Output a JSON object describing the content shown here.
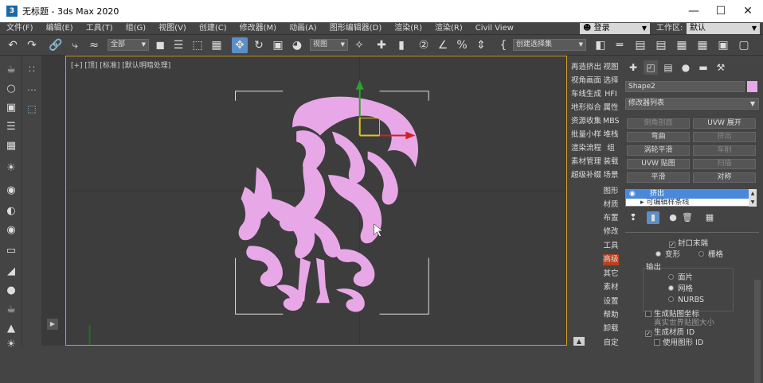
{
  "window": {
    "title": "无标题 - 3ds Max 2020",
    "app_icon": "3ds"
  },
  "menu": [
    "文件(F)",
    "编辑(E)",
    "工具(T)",
    "组(G)",
    "视图(V)",
    "创建(C)",
    "修改器(M)",
    "动画(A)",
    "图形编辑器(D)",
    "渲染(R)",
    "渲染(R)",
    "Civil View"
  ],
  "signin": {
    "label": "登录"
  },
  "workspace": {
    "label": "工作区:",
    "value": "默认"
  },
  "toolbar": {
    "selection_filter": "全部",
    "ref_coord": "视图",
    "named_selection": "创建选择集"
  },
  "viewport": {
    "label": "[+] [顶] [标准] [默认明暗处理]",
    "object_color": "#e8a8e8",
    "border_color": "#d4a020"
  },
  "right_list": [
    {
      "left": "再造挤出",
      "right": "视图"
    },
    {
      "left": "视角画面",
      "right": "选择"
    },
    {
      "left": "车线生成",
      "right": "HFI"
    },
    {
      "left": "地形拟合",
      "right": "属性"
    },
    {
      "left": "资源收集",
      "right": "MBS"
    },
    {
      "left": "批量小样",
      "right": "堆栈"
    },
    {
      "left": "渲染流程",
      "right": "组"
    },
    {
      "left": "素材管理",
      "right": "装载"
    },
    {
      "left": "超级补缀",
      "right": "场景"
    }
  ],
  "right_list_single": [
    "图形",
    "材质",
    "布置",
    "修改",
    "工具",
    "高级",
    "其它",
    "素材",
    "设置",
    "帮助",
    "卸载",
    "自定"
  ],
  "command_panel": {
    "object_name": "Shape2",
    "modifier_list": "修改器列表",
    "buttons": [
      [
        "倒角剖面",
        "UVW 展开"
      ],
      [
        "弯曲",
        "挤出"
      ],
      [
        "涡轮平滑",
        "车削"
      ],
      [
        "UVW 贴图",
        "扫描"
      ],
      [
        "平滑",
        "对称"
      ]
    ],
    "stack": {
      "item1": "挤出",
      "item2": "可编辑样条线"
    },
    "options": {
      "cap_end": "封口末端",
      "morph": "变形",
      "grid": "栅格",
      "output_label": "输出",
      "output_patch": "面片",
      "output_mesh": "网格",
      "output_nurbs": "NURBS",
      "gen_mapping": "生成贴图坐标",
      "real_world": "真实世界贴图大小",
      "gen_mat_ids": "生成材质 ID",
      "use_shape_ids": "使用图形 ID"
    }
  }
}
